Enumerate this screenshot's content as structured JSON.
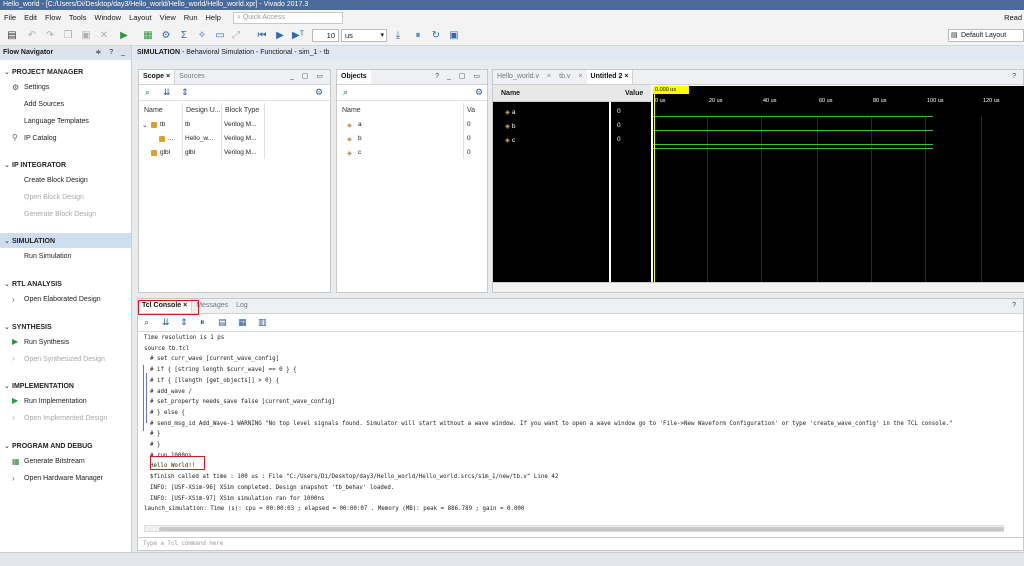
{
  "window": {
    "title": "Hello_world - [C:/Users/Di/Desktop/day3/Hello_world/Hello_world/Hello_world.xpr] - Vivado 2017.3",
    "ready": "Read"
  },
  "menu": [
    "File",
    "Edit",
    "Flow",
    "Tools",
    "Window",
    "Layout",
    "View",
    "Run",
    "Help"
  ],
  "quick_access": "Quick Access",
  "toolbar": {
    "time_value": "10",
    "time_unit": "us",
    "layout": "Default Layout"
  },
  "flow_nav": {
    "title": "Flow Navigator",
    "sections": {
      "project_manager": "PROJECT MANAGER",
      "ip_integrator": "IP INTEGRATOR",
      "simulation": "SIMULATION",
      "rtl_analysis": "RTL ANALYSIS",
      "synthesis": "SYNTHESIS",
      "implementation": "IMPLEMENTATION",
      "program_debug": "PROGRAM AND DEBUG"
    },
    "items": {
      "settings": "Settings",
      "add_sources": "Add Sources",
      "language_templates": "Language Templates",
      "ip_catalog": "IP Catalog",
      "create_block_design": "Create Block Design",
      "open_block_design": "Open Block Design",
      "generate_block_design": "Generate Block Design",
      "run_simulation": "Run Simulation",
      "open_elaborated_design": "Open Elaborated Design",
      "run_synthesis": "Run Synthesis",
      "open_synthesized_design": "Open Synthesized Design",
      "run_implementation": "Run Implementation",
      "open_implemented_design": "Open Implemented Design",
      "generate_bitstream": "Generate Bitstream",
      "open_hardware_manager": "Open Hardware Manager"
    }
  },
  "main_header": {
    "prefix": "SIMULATION",
    "detail": " - Behavioral Simulation - Functional - sim_1 - tb"
  },
  "scope": {
    "tabs": [
      "Scope",
      "Sources"
    ],
    "columns": [
      "Name",
      "Design U...",
      "Block Type"
    ],
    "rows": [
      {
        "name": "tb",
        "unit": "tb",
        "type": "Verilog M..."
      },
      {
        "name": "...",
        "unit": "Hello_w...",
        "type": "Verilog M..."
      },
      {
        "name": "glbl",
        "unit": "glbl",
        "type": "Verilog M..."
      }
    ]
  },
  "objects": {
    "tab": "Objects",
    "columns": [
      "Name",
      "Va"
    ],
    "rows": [
      {
        "name": "a",
        "value": "0"
      },
      {
        "name": "b",
        "value": "0"
      },
      {
        "name": "c",
        "value": "0"
      }
    ]
  },
  "wave": {
    "tabs": [
      "Hello_world.v",
      "tb.v",
      "Untitled 2"
    ],
    "name_header": "Name",
    "value_header": "Value",
    "cursor": "0.000 us",
    "ticks": [
      "0 us",
      "20 us",
      "40 us",
      "60 us",
      "80 us",
      "100 us",
      "120 us"
    ],
    "signals": [
      {
        "name": "a",
        "value": "0"
      },
      {
        "name": "b",
        "value": "0"
      },
      {
        "name": "c",
        "value": "0"
      }
    ]
  },
  "console": {
    "tabs": [
      "Tcl Console",
      "Messages",
      "Log"
    ],
    "lines": [
      "Time resolution is 1 ps",
      "source tb.tcl",
      "# set curr_wave [current_wave_config]",
      "# if { [string length $curr_wave] == 0 } {",
      "#   if { [llength [get_objects]] > 0} {",
      "#     add_wave /",
      "#     set_property needs_save false [current_wave_config]",
      "#   } else {",
      "#     send_msg_id Add_Wave-1 WARNING \"No top level signals found. Simulator will start without a wave window. If you want to open a wave window go to 'File->New Waveform Configuration' or type 'create_wave_config' in the TCL console.\"",
      "#   }",
      "# }",
      "# run 1000ns",
      "Hello World!!",
      "$finish called at time : 100 us : File \"C:/Users/Di/Desktop/day3/Hello_world/Hello_world.srcs/sim_1/new/tb.v\" Line 42",
      "INFO: [USF-XSim-96] XSim completed. Design snapshot 'tb_behav' loaded.",
      "INFO: [USF-XSim-97] XSim simulation ran for 1000ns",
      "launch_simulation: Time (s): cpu = 00:00:03 ; elapsed = 00:00:07 . Memory (MB): peak = 886.789 ; gain = 0.000"
    ],
    "input_placeholder": "Type a Tcl command here"
  }
}
